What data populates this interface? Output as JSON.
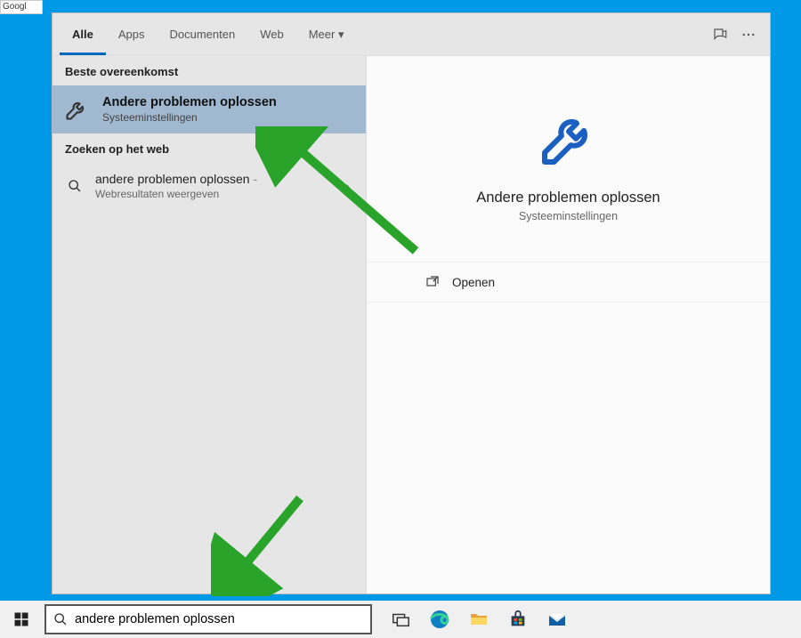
{
  "chrome_tab": "Googl",
  "tabs": {
    "all": "Alle",
    "apps": "Apps",
    "docs": "Documenten",
    "web": "Web",
    "more": "Meer"
  },
  "sections": {
    "best_match": "Beste overeenkomst",
    "web_search": "Zoeken op het web"
  },
  "best_match": {
    "title": "Andere problemen oplossen",
    "subtitle": "Systeeminstellingen"
  },
  "web_result": {
    "title": "andere problemen oplossen",
    "dash": "-",
    "subtitle": "Webresultaten weergeven"
  },
  "detail": {
    "title": "Andere problemen oplossen",
    "subtitle": "Systeeminstellingen",
    "open": "Openen"
  },
  "search": {
    "value": "andere problemen oplossen"
  }
}
